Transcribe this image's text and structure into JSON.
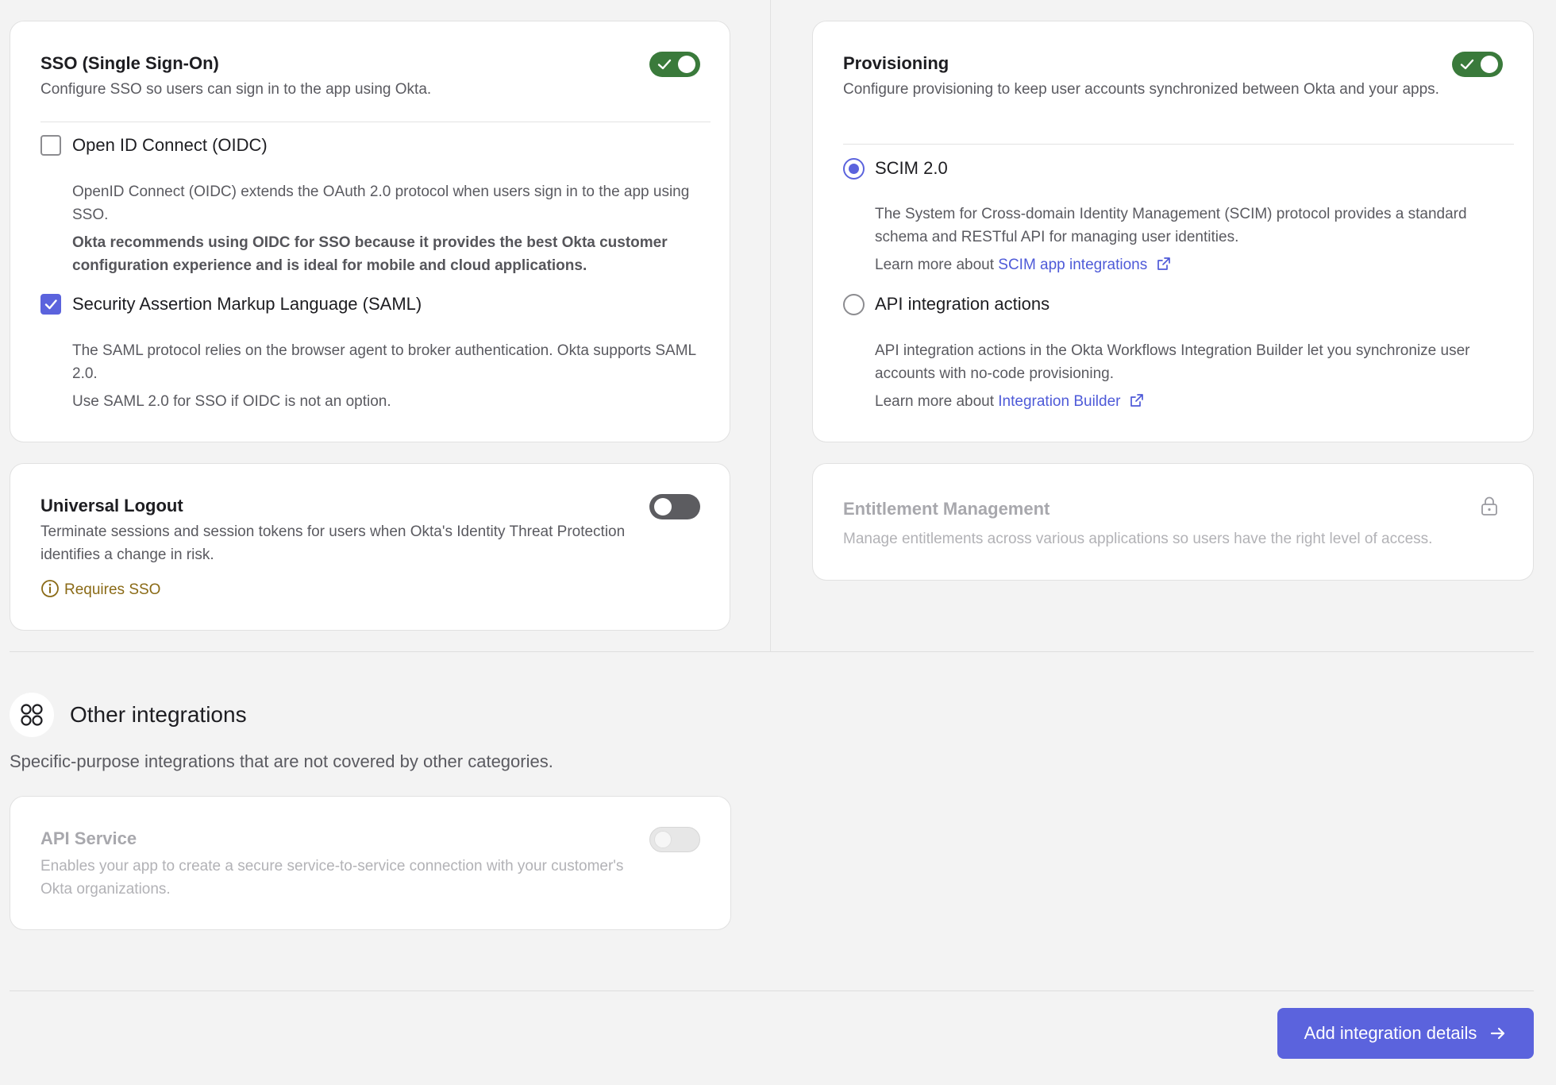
{
  "sso": {
    "title": "SSO (Single Sign-On)",
    "description": "Configure SSO so users can sign in to the app using Okta.",
    "toggle_on": true,
    "oidc": {
      "label": "Open ID Connect (OIDC)",
      "checked": false,
      "desc1": "OpenID Connect (OIDC) extends the OAuth 2.0 protocol when users sign in to the app using SSO.",
      "desc2": "Okta recommends using OIDC for SSO because it provides the best Okta customer configuration experience and is ideal for mobile and cloud applications."
    },
    "saml": {
      "label": "Security Assertion Markup Language (SAML)",
      "checked": true,
      "desc1": "The SAML protocol relies on the browser agent to broker authentication. Okta supports SAML 2.0.",
      "desc2": "Use SAML 2.0 for SSO if OIDC is not an option."
    }
  },
  "provisioning": {
    "title": "Provisioning",
    "description": "Configure provisioning to keep user accounts synchronized between Okta and your apps.",
    "toggle_on": true,
    "scim": {
      "label": "SCIM 2.0",
      "selected": true,
      "desc": "The System for Cross-domain Identity Management (SCIM) protocol provides a standard schema and RESTful API for managing user identities.",
      "learn_prefix": "Learn more about ",
      "learn_link": "SCIM app integrations"
    },
    "api_actions": {
      "label": "API integration actions",
      "selected": false,
      "desc": "API integration actions in the Okta Workflows Integration Builder let you synchronize user accounts with no-code provisioning.",
      "learn_prefix": "Learn more about ",
      "learn_link": "Integration Builder"
    }
  },
  "universal_logout": {
    "title": "Universal Logout",
    "description": "Terminate sessions and session tokens for users when Okta's Identity Threat Protection identifies a change in risk.",
    "toggle_on": false,
    "warning": "Requires SSO"
  },
  "entitlement": {
    "title": "Entitlement Management",
    "description": "Manage entitlements across various applications so users have the right level of access.",
    "icon": "lock-icon"
  },
  "other": {
    "title": "Other integrations",
    "description": "Specific-purpose integrations that are not covered by other categories.",
    "icon": "grid-icon"
  },
  "api_service": {
    "title": "API Service",
    "description": "Enables your app to create a secure service-to-service connection with your customer's Okta organizations.",
    "toggle_on": false
  },
  "footer": {
    "primary_label": "Add integration details"
  },
  "colors": {
    "accent": "#5b63dd",
    "toggle_on": "#3a7a3b",
    "link": "#4e5ad8",
    "warning": "#8a6a16"
  }
}
